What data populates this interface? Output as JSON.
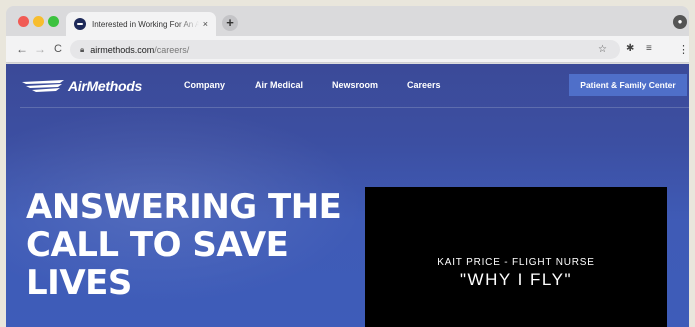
{
  "browser": {
    "tab": {
      "title": "Interested in Working For An Ai",
      "close": "×"
    },
    "new_tab": "+",
    "nav": {
      "back": "←",
      "forward": "→",
      "reload": "C"
    },
    "address": {
      "host": "airmethods.com",
      "path": "/careers/"
    },
    "icons": [
      "lock-icon",
      "star-icon",
      "extensions-icon",
      "reading-list-icon",
      "menu-icon"
    ]
  },
  "site": {
    "logo": {
      "text": "AirMethods"
    },
    "nav": {
      "company": "Company",
      "air_medical": "Air Medical",
      "newsroom": "Newsroom",
      "careers": "Careers"
    },
    "cta": "Patient & Family Center"
  },
  "hero": {
    "title": "ANSWERING THE CALL TO SAVE LIVES"
  },
  "video": {
    "subtitle": "KAIT PRICE - FLIGHT NURSE",
    "title": "\"WHY I FLY\""
  },
  "colors": {
    "hero_bg": "#3c4fa2",
    "cta_bg": "#4f6fc9",
    "video_bg": "#000000"
  }
}
